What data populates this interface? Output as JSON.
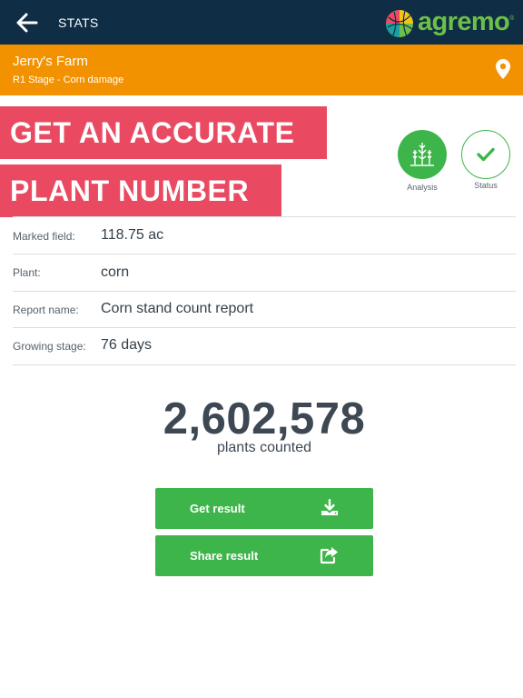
{
  "topbar": {
    "title": "STATS",
    "brand_name": "agremo",
    "brand_tm": "®",
    "back_icon": "arrow-left-icon"
  },
  "farm": {
    "name": "Jerry's Farm",
    "subtitle": "R1 Stage - Corn damage",
    "location_icon": "map-pin-icon"
  },
  "banner": {
    "line1": "GET AN ACCURATE",
    "line2": "PLANT NUMBER"
  },
  "status_buttons": {
    "analysis_label": "Analysis",
    "status_label": "Status"
  },
  "details": {
    "marked_field_label": "Marked field:",
    "marked_field_value": "118.75 ac",
    "plant_label": "Plant:",
    "plant_value": "corn",
    "report_name_label": "Report name:",
    "report_name_value": "Corn stand count report",
    "growing_stage_label": "Growing stage:",
    "growing_stage_value": "76 days"
  },
  "count": {
    "value": "2,602,578",
    "caption": "plants counted"
  },
  "actions": {
    "get_result_label": "Get result",
    "share_result_label": "Share result"
  },
  "colors": {
    "topbar": "#0f2d44",
    "farmbar": "#f39200",
    "accent_green": "#3db54a",
    "banner": "#ea4a61",
    "text_dark": "#3d4853"
  }
}
